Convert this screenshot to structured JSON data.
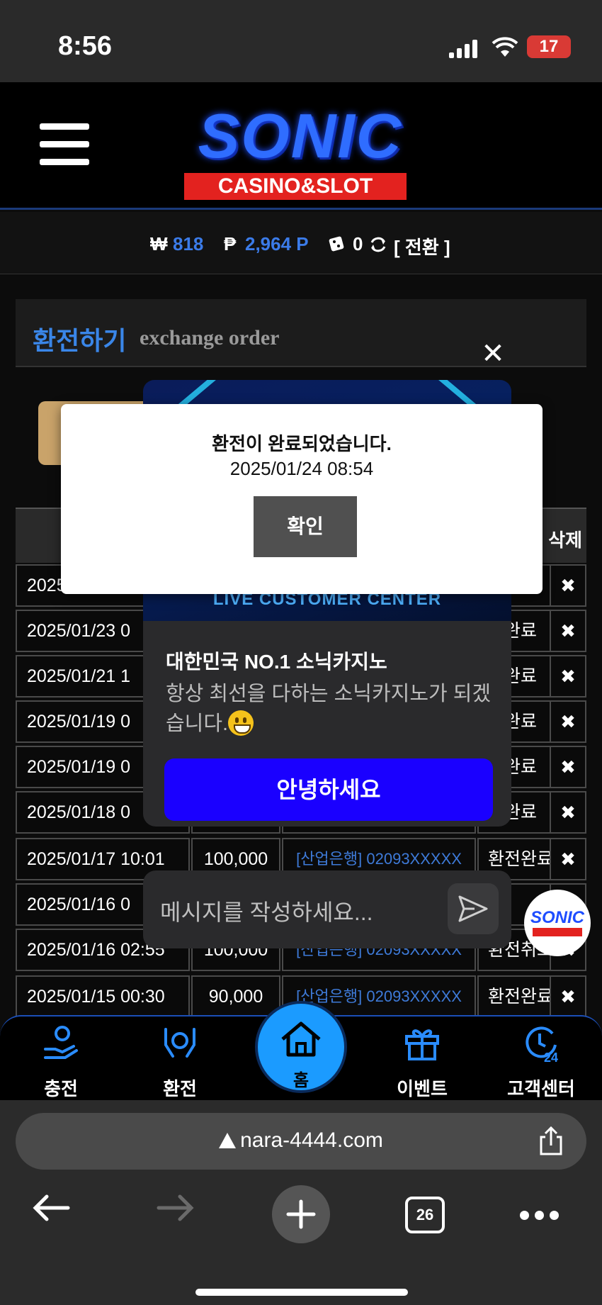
{
  "status_bar": {
    "time": "8:56",
    "battery": "17"
  },
  "header": {
    "logo_main": "SONIC",
    "logo_sub": "CASINO&SLOT"
  },
  "balance": {
    "won_symbol": "₩",
    "won_value": "818",
    "point_symbol": "₱",
    "point_value": "2,964 P",
    "chip_value": "0",
    "convert_label": "[ 전환 ]"
  },
  "section": {
    "title_ko": "환전하기",
    "title_en": "exchange order"
  },
  "table": {
    "delete_header": "삭제",
    "rows": [
      {
        "date": "2025",
        "amount": "",
        "bank": "",
        "status": "",
        "del": "✖"
      },
      {
        "date": "2025/01/23 0",
        "amount": "",
        "bank": "",
        "status": "완료",
        "del": "✖"
      },
      {
        "date": "2025/01/21 1",
        "amount": "",
        "bank": "",
        "status": "완료",
        "del": "✖"
      },
      {
        "date": "2025/01/19 0",
        "amount": "",
        "bank": "",
        "status": "완료",
        "del": "✖"
      },
      {
        "date": "2025/01/19 0",
        "amount": "",
        "bank": "",
        "status": "완료",
        "del": "✖"
      },
      {
        "date": "2025/01/18 0",
        "amount": "",
        "bank": "",
        "status": "완료",
        "del": "✖"
      },
      {
        "date": "2025/01/17 10:01",
        "amount": "100,000",
        "bank": "[산업은행] 02093XXXXX",
        "status": "환전완료",
        "del": "✖"
      },
      {
        "date": "2025/01/16 0",
        "amount": "",
        "bank": "",
        "status": "",
        "del": "✖"
      },
      {
        "date": "2025/01/16 02:55",
        "amount": "100,000",
        "bank": "[산업은행] 02093XXXXX",
        "status": "환전취소",
        "del": "✖"
      },
      {
        "date": "2025/01/15 00:30",
        "amount": "90,000",
        "bank": "[산업은행] 02093XXXXX",
        "status": "환전완료",
        "del": "✖"
      }
    ]
  },
  "chat": {
    "banner_text": "LIVE CUSTOMER CENTER",
    "title": "대한민국 NO.1 소닉카지노",
    "body": "항상 최선을 다하는 소닉카지노가 되겠습니다.",
    "hello_button": "안녕하세요",
    "message_placeholder": "메시지를 작성하세요...",
    "close": "✕",
    "float_logo": "SONIC"
  },
  "modal": {
    "message": "환전이 완료되었습니다.",
    "datetime": "2025/01/24 08:54",
    "ok_label": "확인"
  },
  "bottom_nav": {
    "charge": "충전",
    "exchange": "환전",
    "home": "홈",
    "event": "이벤트",
    "support": "고객센터"
  },
  "browser": {
    "url": "nara-4444.com",
    "tab_count": "26"
  }
}
